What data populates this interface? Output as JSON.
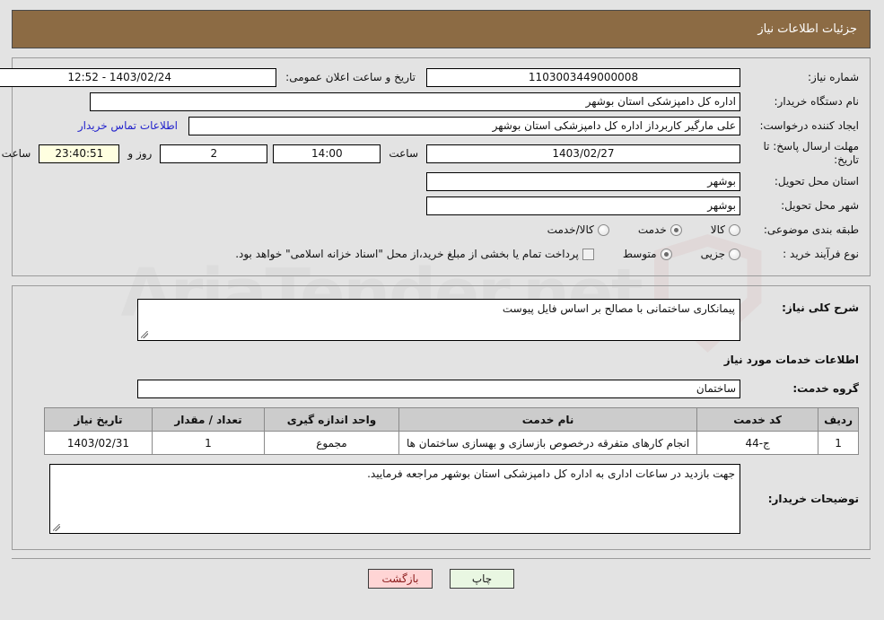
{
  "header": {
    "title": "جزئیات اطلاعات نیاز"
  },
  "watermark": {
    "text": "AriaTender.net"
  },
  "top_panel": {
    "need_number": {
      "label": "شماره نیاز:",
      "value": "1103003449000008"
    },
    "announce": {
      "label": "تاریخ و ساعت اعلان عمومی:",
      "value": "12:52 - 1403/02/24"
    },
    "buyer_org": {
      "label": "نام دستگاه خریدار:",
      "value": "اداره کل دامپزشکی استان بوشهر"
    },
    "request_creator": {
      "label": "ایجاد کننده درخواست:",
      "value": "علی مارگیر کاربرداز اداره کل دامپزشکی استان بوشهر"
    },
    "contact_link": "اطلاعات تماس خریدار",
    "deadline": {
      "label_line1": "مهلت ارسال پاسخ: تا",
      "label_line2": "تاریخ:",
      "date": "1403/02/27",
      "time_label": "ساعت",
      "time": "14:00",
      "days": "2",
      "days_label": "روز و",
      "countdown": "23:40:51",
      "remaining_label": "ساعت باقی مانده"
    },
    "province": {
      "label": "استان محل تحویل:",
      "value": "بوشهر"
    },
    "city": {
      "label": "شهر محل تحویل:",
      "value": "بوشهر"
    },
    "category": {
      "label": "طبقه بندی موضوعی:",
      "options": [
        {
          "label": "کالا",
          "checked": false
        },
        {
          "label": "خدمت",
          "checked": true
        },
        {
          "label": "کالا/خدمت",
          "checked": false
        }
      ]
    },
    "purchase_type": {
      "label": "نوع فرآیند خرید :",
      "options": [
        {
          "label": "جزیی",
          "checked": false
        },
        {
          "label": "متوسط",
          "checked": true
        }
      ],
      "checkbox_label": "پرداخت تمام یا بخشی از مبلغ خرید،از محل \"اسناد خزانه اسلامی\" خواهد بود.",
      "checkbox_checked": false
    }
  },
  "description_panel": {
    "general_desc": {
      "label": "شرح کلی نیاز:",
      "value": "پیمانکاری ساختمانی با مصالح بر اساس فایل پیوست"
    },
    "services_heading": "اطلاعات خدمات مورد نیاز",
    "service_group": {
      "label": "گروه خدمت:",
      "value": "ساختمان"
    },
    "table": {
      "columns": [
        "ردیف",
        "کد خدمت",
        "نام خدمت",
        "واحد اندازه گیری",
        "تعداد / مقدار",
        "تاریخ نیاز"
      ],
      "rows": [
        {
          "row": "1",
          "code": "ج-44",
          "name": "انجام کارهای متفرقه درخصوص بازسازی و بهسازی ساختمان ها",
          "unit": "مجموع",
          "quantity": "1",
          "need_date": "1403/02/31"
        }
      ]
    },
    "buyer_notes": {
      "label": "توضیحات خریدار:",
      "value": "جهت بازدید در ساعات اداری به اداره کل دامپزشکی استان بوشهر مراجعه فرمایید."
    }
  },
  "footer": {
    "back_button": "بازگشت",
    "print_button": "چاپ"
  },
  "colors": {
    "header_brown": "#8c6b44",
    "page_bg": "#e3e3e3",
    "link_blue": "#2222cc",
    "back_btn_bg": "#ffd5d5",
    "print_btn_bg": "#e9f7e2",
    "countdown_bg": "#ffffe0",
    "table_header_bg": "#cccccc"
  }
}
